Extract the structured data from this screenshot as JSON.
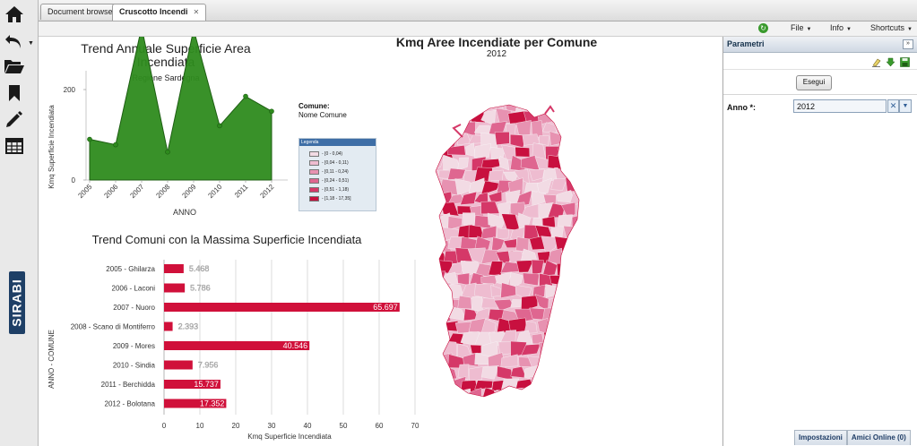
{
  "tabs": [
    "Document browser",
    "Cruscotto Incendi"
  ],
  "menubar": {
    "file": "File",
    "info": "Info",
    "shortcuts": "Shortcuts"
  },
  "brand": "SIRABI",
  "area_chart": {
    "title_line1": "Trend Annuale Superficie Area",
    "title_line2": "Incendiata",
    "subtitle": "Regione Sardegna",
    "xlabel": "ANNO",
    "ylabel": "Kmq Superficie Incendiata"
  },
  "bar_chart": {
    "title": "Trend Comuni con la Massima Superficie Incendiata",
    "xlabel": "Kmq Superficie Incendiata",
    "ylabel": "ANNO - COMUNE"
  },
  "chart_data": [
    {
      "type": "area",
      "title": "Trend Annuale Superficie Area Incendiata",
      "subtitle": "Regione Sardegna",
      "xlabel": "ANNO",
      "ylabel": "Kmq Superficie Incendiata",
      "x": [
        "2005",
        "2006",
        "2007",
        "2008",
        "2009",
        "2010",
        "2011",
        "2012"
      ],
      "values": [
        90,
        78,
        338,
        62,
        333,
        120,
        185,
        152
      ],
      "yticks": [
        0,
        200,
        400
      ],
      "ylim": [
        0,
        450
      ],
      "color": "#2e8b1e"
    },
    {
      "type": "bar",
      "orientation": "horizontal",
      "title": "Trend Comuni con la Massima Superficie Incendiata",
      "xlabel": "Kmq Superficie Incendiata",
      "ylabel": "ANNO - COMUNE",
      "categories": [
        "2005 - Ghilarza",
        "2006 - Laconi",
        "2007 - Nuoro",
        "2008 - Scano di Montiferro",
        "2009 - Mores",
        "2010 - Sindia",
        "2011 - Berchidda",
        "2012 - Bolotana"
      ],
      "values": [
        5.468,
        5.786,
        65.697,
        2.393,
        40.546,
        7.956,
        15.737,
        17.352
      ],
      "value_labels": [
        "5.468",
        "5.786",
        "65.697",
        "2.393",
        "40.546",
        "7.956",
        "15.737",
        "17.352"
      ],
      "xticks": [
        0,
        10,
        20,
        30,
        40,
        50,
        60,
        70
      ],
      "xlim": [
        0,
        70
      ],
      "color": "#d0103a",
      "grid": true
    }
  ],
  "map": {
    "title": "Kmq Aree Incendiate per Comune",
    "year": "2012",
    "legend_header": "Comune:",
    "legend_sub": "Nome Comune",
    "legend_title": "Legenda",
    "legend_items": [
      {
        "label": "- [0 - 0,04)",
        "color": "#f2dbe4"
      },
      {
        "label": "- [0,04 - 0,11)",
        "color": "#eebcd0"
      },
      {
        "label": "- [0,11 - 0,24)",
        "color": "#e792b1"
      },
      {
        "label": "- [0,24 - 0,51)",
        "color": "#df6690"
      },
      {
        "label": "- [0,51 - 1,18)",
        "color": "#d53868"
      },
      {
        "label": "- [1,18 - 17,35]",
        "color": "#c8103f"
      }
    ]
  },
  "panel": {
    "title": "Parametri",
    "run_button": "Esegui",
    "anno_label": "Anno *:",
    "anno_value": "2012"
  },
  "status": {
    "settings": "Impostazioni",
    "friends": "Amici Online (0)"
  }
}
